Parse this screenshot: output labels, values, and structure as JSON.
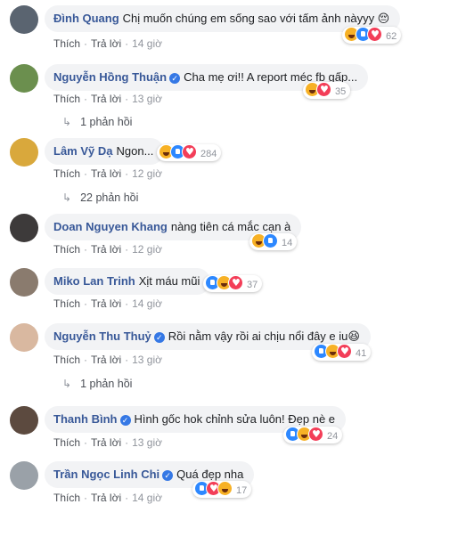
{
  "labels": {
    "like": "Thích",
    "reply": "Trả lời",
    "dot": "·"
  },
  "comments": [
    {
      "author": "Đình Quang",
      "verified": false,
      "text": "Chị muốn chúng em sống sao với tấm ảnh nàyyy 😔",
      "reacts": [
        "haha",
        "like",
        "love"
      ],
      "count": "62",
      "time": "14 giờ",
      "avatar": "#5a6470"
    },
    {
      "author": "Nguyễn Hồng Thuận",
      "verified": true,
      "text": "Cha mẹ ơi!! A report méc fb gấp...",
      "reacts": [
        "haha",
        "love"
      ],
      "count": "35",
      "time": "13 giờ",
      "replies": "1 phản hồi",
      "avatar": "#6b8f4e"
    },
    {
      "author": "Lâm Vỹ Dạ",
      "verified": false,
      "text": "Ngon...",
      "reacts": [
        "haha",
        "like",
        "love"
      ],
      "count": "284",
      "time": "12 giờ",
      "replies": "22 phản hồi",
      "avatar": "#d9a83c"
    },
    {
      "author": "Doan Nguyen Khang",
      "verified": false,
      "text": "nàng tiên cá mắc cạn à",
      "reacts": [
        "haha",
        "like"
      ],
      "count": "14",
      "time": "12 giờ",
      "avatar": "#3d3a3a"
    },
    {
      "author": "Miko Lan Trinh",
      "verified": false,
      "text": "Xịt máu mũi",
      "reacts": [
        "like",
        "haha",
        "love"
      ],
      "count": "37",
      "time": "14 giờ",
      "avatar": "#8a7b6e"
    },
    {
      "author": "Nguyễn Thu Thuỷ",
      "verified": true,
      "text": "Rồi nằm vậy rồi ai chịu nổi đây e iu😆",
      "reacts": [
        "like",
        "haha",
        "love"
      ],
      "count": "41",
      "time": "13 giờ",
      "replies": "1 phản hồi",
      "avatar": "#d9b8a0"
    },
    {
      "author": "Thanh Bình",
      "verified": true,
      "text": "Hình gốc hok chỉnh sửa luôn! Đẹp nè e",
      "reacts": [
        "like",
        "haha",
        "love"
      ],
      "count": "24",
      "time": "13 giờ",
      "avatar": "#5c4a3f"
    },
    {
      "author": "Trần Ngọc Linh Chi",
      "verified": false,
      "text": "Quá đẹp nha",
      "reacts": [
        "like",
        "love",
        "haha"
      ],
      "count": "17",
      "time": "14 giờ",
      "avatar": "#9aa1a8"
    }
  ]
}
